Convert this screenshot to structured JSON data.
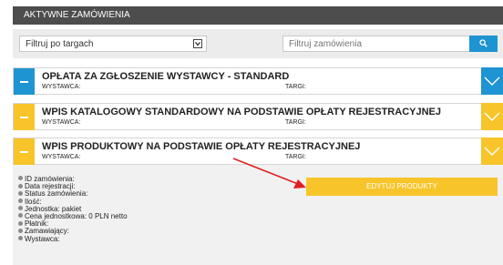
{
  "header": {
    "title": "AKTYWNE ZAMÓWIENIA"
  },
  "filters": {
    "fair_select_value": "Filtruj po targach",
    "search_placeholder": "Filtruj zamówienia",
    "search_icon": "search-icon"
  },
  "orders": [
    {
      "title": "OPŁATA ZA ZGŁOSZENIE WYSTAWCY - STANDARD",
      "exhibitor_label": "WYSTAWCA:",
      "fair_label": "TARGI:",
      "accent": "#1e94d2",
      "expanded": false
    },
    {
      "title": "WPIS KATALOGOWY STANDARDOWY NA PODSTAWIE OPŁATY REJESTRACYJNEJ",
      "exhibitor_label": "WYSTAWCA:",
      "fair_label": "TARGI:",
      "accent": "#f7c52a",
      "expanded": false
    },
    {
      "title": "WPIS PRODUKTOWY NA PODSTAWIE OPŁATY REJESTRACYJNEJ",
      "exhibitor_label": "WYSTAWCA:",
      "fair_label": "TARGI:",
      "accent": "#f7c52a",
      "expanded": true
    }
  ],
  "details": {
    "fields": [
      "ID zamówienia:",
      "Data rejestracji:",
      "Status zamówienia:",
      "Ilość:",
      "Jednostka: pakiet",
      "Cena jednostkowa: 0 PLN netto",
      "Płatnik:",
      "Zamawiający:",
      "Wystawca:"
    ],
    "edit_button_label": "EDYTUJ PRODUKTY"
  },
  "colors": {
    "blue": "#1e94d2",
    "yellow": "#f7c52a",
    "header_bg": "#4d4d4d",
    "annotation_arrow": "#e02020"
  }
}
